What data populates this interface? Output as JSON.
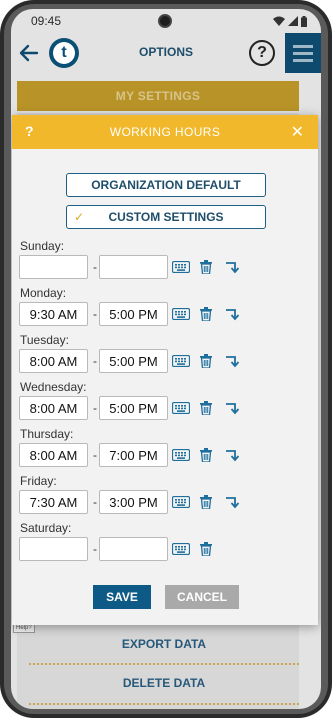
{
  "status_bar": {
    "time": "09:45"
  },
  "app_bar": {
    "title": "OPTIONS",
    "help_label": "?",
    "logo_letter": "t"
  },
  "background": {
    "my_settings_label": "MY SETTINGS",
    "export_data_label": "EXPORT DATA",
    "delete_data_label": "DELETE DATA",
    "help_tag": "Help?"
  },
  "modal": {
    "help_label": "?",
    "title": "WORKING HOURS",
    "close_label": "✕",
    "option_default": "ORGANIZATION DEFAULT",
    "option_custom": "CUSTOM SETTINGS",
    "selected_option": "custom",
    "days": [
      {
        "name": "Sunday:",
        "start": "",
        "end": ""
      },
      {
        "name": "Monday:",
        "start": "9:30 AM",
        "end": "5:00 PM"
      },
      {
        "name": "Tuesday:",
        "start": "8:00 AM",
        "end": "5:00 PM"
      },
      {
        "name": "Wednesday:",
        "start": "8:00 AM",
        "end": "5:00 PM"
      },
      {
        "name": "Thursday:",
        "start": "8:00 AM",
        "end": "7:00 PM"
      },
      {
        "name": "Friday:",
        "start": "7:30 AM",
        "end": "3:00 PM"
      },
      {
        "name": "Saturday:",
        "start": "",
        "end": ""
      }
    ],
    "save_label": "SAVE",
    "cancel_label": "CANCEL"
  },
  "colors": {
    "header_yellow": "#f0b82a",
    "primary_blue": "#0e5a86",
    "icon_blue": "#1f6f9e",
    "menu_navy": "#0e4a6e"
  },
  "icons": {
    "back": "back-arrow-icon",
    "keyboard": "keyboard-icon",
    "delete": "trash-icon",
    "copy_down": "copy-down-arrow-icon",
    "menu": "hamburger-menu-icon"
  }
}
